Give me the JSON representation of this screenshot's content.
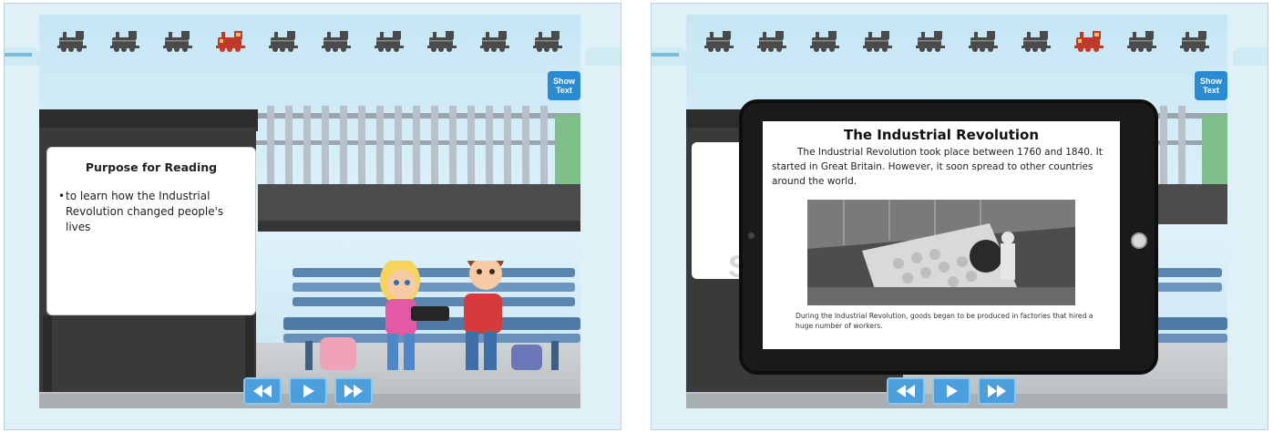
{
  "left_slide": {
    "progress": {
      "total": 10,
      "current_index": 3,
      "icons": [
        "train-icon",
        "train-icon",
        "train-icon",
        "train-icon-current",
        "train-icon",
        "train-icon",
        "train-icon",
        "train-icon",
        "train-icon",
        "train-icon"
      ]
    },
    "show_text": {
      "line1": "Show",
      "line2": "Text"
    },
    "purpose_card": {
      "title": "Purpose for Reading",
      "bullet": "to learn how the Industrial Revolution changed people's lives"
    }
  },
  "right_slide": {
    "progress": {
      "total": 10,
      "current_index": 7,
      "icons": [
        "train-icon",
        "train-icon",
        "train-icon",
        "train-icon",
        "train-icon",
        "train-icon",
        "train-icon",
        "train-icon-current",
        "train-icon",
        "train-icon"
      ]
    },
    "show_text": {
      "line1": "Show",
      "line2": "Text"
    },
    "tablet": {
      "title": "The Industrial Revolution",
      "body": "The Industrial Revolution took place between 1760 and 1840. It started in Great Britain. However, it soon spread to other countries around the world.",
      "caption": "During the Industrial Revolution, goods began to be produced in factories that hired a huge number of workers."
    },
    "background_card_letter": "S"
  },
  "controls": {
    "rewind_icon": "rewind-icon",
    "play_icon": "play-icon",
    "forward_icon": "fast-forward-icon"
  },
  "colors": {
    "accent_blue": "#4a9fdc",
    "show_text_blue": "#2a8bd2",
    "train_dark": "#4a4a4a",
    "train_current": "#c0392b"
  }
}
